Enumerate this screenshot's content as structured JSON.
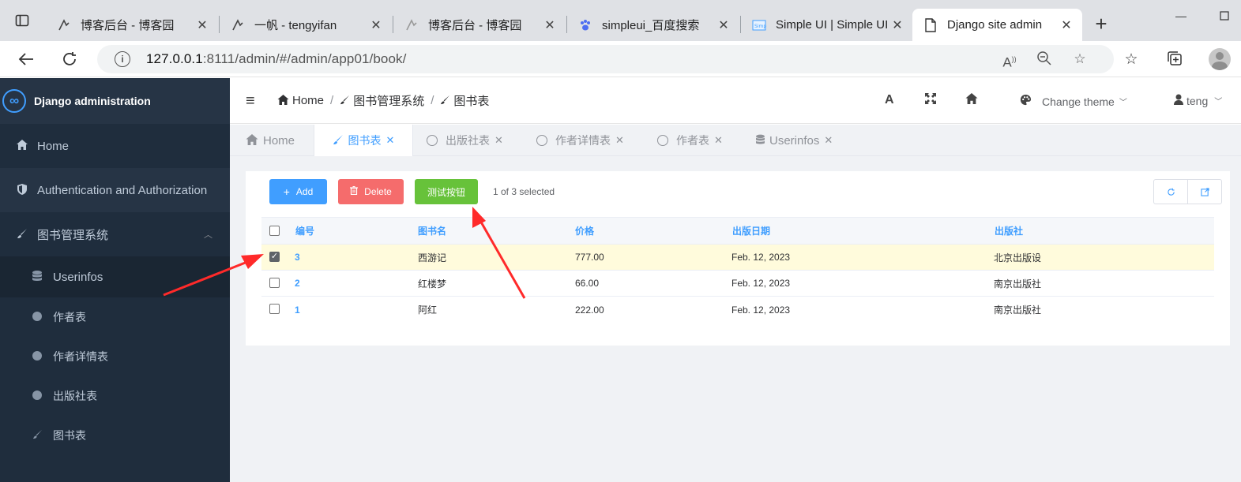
{
  "browser": {
    "tabs": [
      {
        "title": "博客后台 - 博客园",
        "favicon": "cnblogs-icon"
      },
      {
        "title": "一帆 - tengyifan",
        "favicon": "cnblogs-icon"
      },
      {
        "title": "博客后台 - 博客园",
        "favicon": "cnblogs-icon"
      },
      {
        "title": "simpleui_百度搜索",
        "favicon": "baidu-paw-icon"
      },
      {
        "title": "Simple UI | Simple UI",
        "favicon": "simpleui-icon"
      },
      {
        "title": "Django site admin",
        "favicon": "document-icon"
      }
    ],
    "url_host": "127.0.0.1",
    "url_rest": ":8111/admin/#/admin/app01/book/"
  },
  "sidebar": {
    "title": "Django administration",
    "items": [
      {
        "label": "Home",
        "icon": "home-icon"
      },
      {
        "label": "Authentication and Authorization",
        "icon": "shield-icon"
      },
      {
        "label": "图书管理系统",
        "icon": "brush-icon"
      }
    ],
    "subitems": [
      {
        "label": "Userinfos",
        "icon": "database-icon"
      },
      {
        "label": "作者表",
        "icon": "circle-icon"
      },
      {
        "label": "作者详情表",
        "icon": "circle-icon"
      },
      {
        "label": "出版社表",
        "icon": "circle-icon"
      },
      {
        "label": "图书表",
        "icon": "brush-icon"
      }
    ]
  },
  "topbar": {
    "breadcrumb": [
      "Home",
      "图书管理系统",
      "图书表"
    ],
    "theme_label": "Change theme",
    "user_label": "teng"
  },
  "app_tabs": [
    {
      "label": "Home",
      "icon": "home-icon"
    },
    {
      "label": "图书表",
      "icon": "brush-icon",
      "active": true
    },
    {
      "label": "出版社表",
      "icon": "circle-icon"
    },
    {
      "label": "作者详情表",
      "icon": "circle-icon"
    },
    {
      "label": "作者表",
      "icon": "circle-icon"
    },
    {
      "label": "Userinfos",
      "icon": "database-icon"
    }
  ],
  "actions": {
    "add_label": "Add",
    "delete_label": "Delete",
    "test_label": "测试按钮",
    "selected_text": "1 of 3 selected"
  },
  "table": {
    "columns": [
      "编号",
      "图书名",
      "价格",
      "出版日期",
      "出版社"
    ],
    "rows": [
      {
        "id": "3",
        "name": "西游记",
        "price": "777.00",
        "date": "Feb. 12, 2023",
        "publisher": "北京出版设",
        "checked": true
      },
      {
        "id": "2",
        "name": "红楼梦",
        "price": "66.00",
        "date": "Feb. 12, 2023",
        "publisher": "南京出版社",
        "checked": false
      },
      {
        "id": "1",
        "name": "阿红",
        "price": "222.00",
        "date": "Feb. 12, 2023",
        "publisher": "南京出版社",
        "checked": false
      }
    ]
  },
  "colors": {
    "sidebar_bg": "#1f2d3d",
    "accent": "#409eff",
    "danger": "#f56c6c",
    "success": "#67c23a",
    "selected_row": "#fffbdc",
    "annotation_arrow": "#ff2a2a"
  }
}
